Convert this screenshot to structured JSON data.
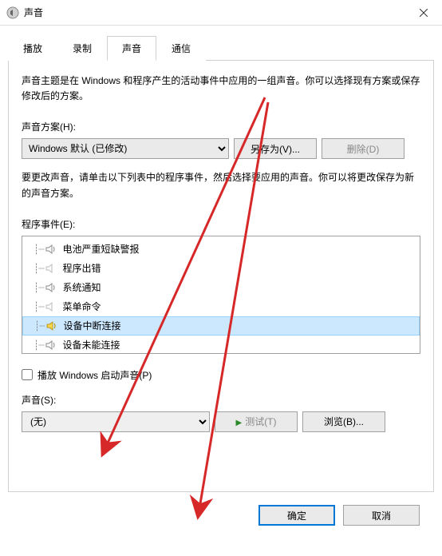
{
  "titlebar": {
    "title": "声音"
  },
  "tabs": [
    {
      "label": "播放"
    },
    {
      "label": "录制"
    },
    {
      "label": "声音"
    },
    {
      "label": "通信"
    }
  ],
  "panel": {
    "intro": "声音主题是在 Windows 和程序产生的活动事件中应用的一组声音。你可以选择现有方案或保存修改后的方案。",
    "scheme_label": "声音方案(H):",
    "scheme_value": "Windows 默认 (已修改)",
    "save_as": "另存为(V)...",
    "delete": "删除(D)",
    "change_hint": "要更改声音，请单击以下列表中的程序事件，然后选择要应用的声音。你可以将更改保存为新的声音方案。",
    "events_label": "程序事件(E):",
    "events": [
      {
        "label": "电池严重短缺警报",
        "has_sound": true
      },
      {
        "label": "程序出错",
        "has_sound": false
      },
      {
        "label": "系统通知",
        "has_sound": true
      },
      {
        "label": "菜单命令",
        "has_sound": false
      },
      {
        "label": "设备中断连接",
        "has_sound": true,
        "selected": true
      },
      {
        "label": "设备未能连接",
        "has_sound": true
      }
    ],
    "play_startup_label": "播放 Windows 启动声音(P)",
    "sound_label": "声音(S):",
    "sound_value": "(无)",
    "test": "测试(T)",
    "browse": "浏览(B)..."
  },
  "buttons": {
    "ok": "确定",
    "cancel": "取消"
  }
}
